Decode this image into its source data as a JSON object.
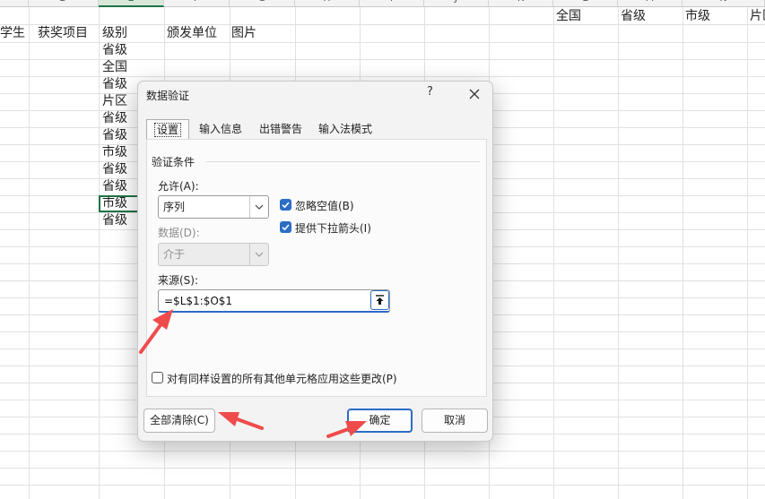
{
  "sheet": {
    "columns": [
      "C",
      "D",
      "E",
      "F",
      "G",
      "H",
      "I",
      "J",
      "K",
      "L",
      "M",
      "N"
    ],
    "selected_column": "E",
    "row1_right": [
      "全国",
      "省级",
      "市级",
      "片区"
    ],
    "row2_headers": [
      "学生",
      "获奖项目",
      "级别",
      "颁发单位",
      "图片"
    ],
    "level_values": [
      "省级",
      "全国",
      "省级",
      "片区",
      "省级",
      "省级",
      "市级",
      "省级",
      "省级",
      "市级",
      "省级"
    ]
  },
  "dialog": {
    "title": "数据验证",
    "help": "?",
    "tabs": [
      "设置",
      "输入信息",
      "出错警告",
      "输入法模式"
    ],
    "active_tab": "设置",
    "group_label": "验证条件",
    "allow_label": "允许(A):",
    "allow_value": "序列",
    "data_label": "数据(D):",
    "data_value": "介于",
    "ignore_blank_label": "忽略空值(B)",
    "ignore_blank_checked": true,
    "dropdown_label": "提供下拉箭头(I)",
    "dropdown_checked": true,
    "source_label": "来源(S):",
    "source_value": "=$L$1:$O$1",
    "apply_all_label": "对有同样设置的所有其他单元格应用这些更改(P)",
    "apply_all_checked": false,
    "clear_all_label": "全部清除(C)",
    "ok_label": "确定",
    "cancel_label": "取消"
  },
  "colors": {
    "accent": "#2b6cc4",
    "excel_green": "#217346",
    "annotation_arrow": "#f04b4b"
  }
}
